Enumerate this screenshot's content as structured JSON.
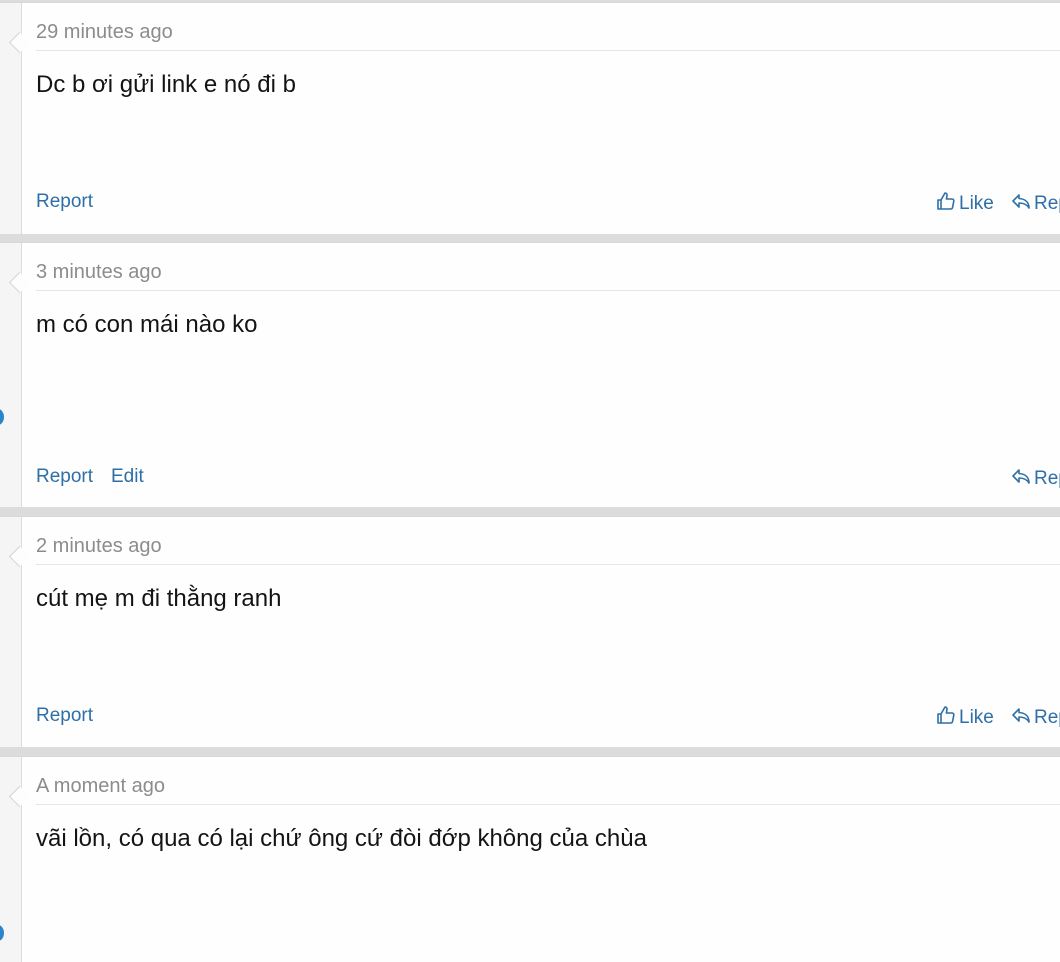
{
  "posts": [
    {
      "time": "29 minutes ago",
      "content": "Dc b ơi gửi link e nó đi b",
      "report": "Report",
      "like": "Like",
      "reply": "Reply"
    },
    {
      "time": "3 minutes ago",
      "content": "m có con mái nào ko",
      "report": "Report",
      "edit": "Edit",
      "reply": "Reply"
    },
    {
      "time": "2 minutes ago",
      "content": "cút mẹ m đi thằng ranh",
      "report": "Report",
      "like": "Like",
      "reply": "Reply"
    },
    {
      "time": "A moment ago",
      "content": "vãi lồn, có qua có lại chứ ông cứ đòi đớp không của chùa"
    }
  ],
  "colors": {
    "link": "#2d6fa6",
    "timestamp": "#8c8c8c",
    "text": "#141414",
    "avatar_accent": "#2a86c8"
  },
  "icons": {
    "like": "thumbs-up-icon",
    "reply": "reply-arrow-icon"
  }
}
